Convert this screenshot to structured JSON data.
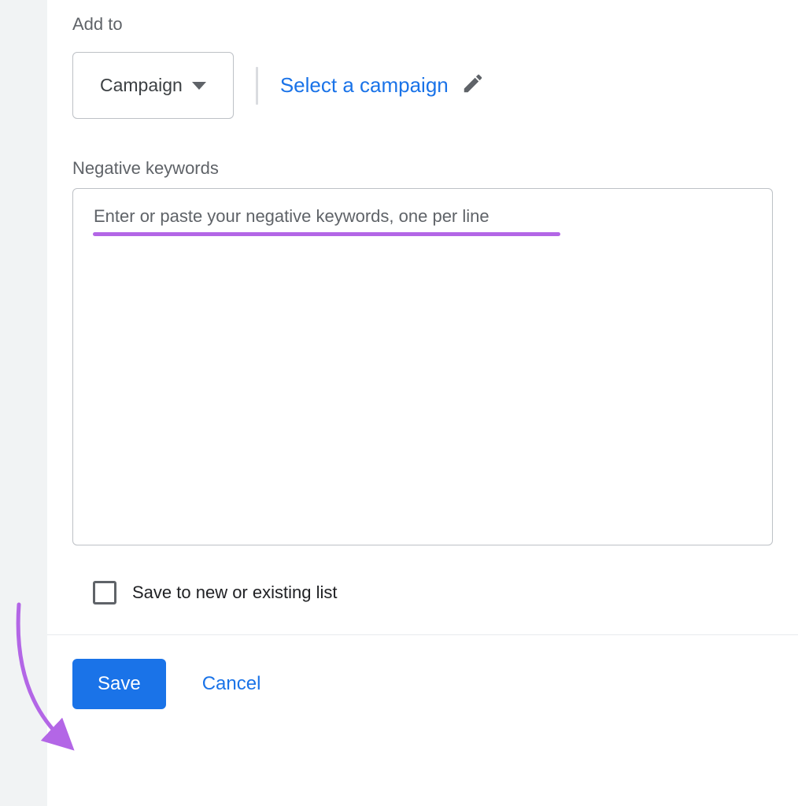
{
  "add_to": {
    "label": "Add to",
    "dropdown_value": "Campaign",
    "select_link": "Select a campaign"
  },
  "negative_keywords": {
    "label": "Negative keywords",
    "placeholder": "Enter or paste your negative keywords, one per line",
    "value": ""
  },
  "checkbox": {
    "label": "Save to new or existing list",
    "checked": false
  },
  "footer": {
    "save": "Save",
    "cancel": "Cancel"
  }
}
